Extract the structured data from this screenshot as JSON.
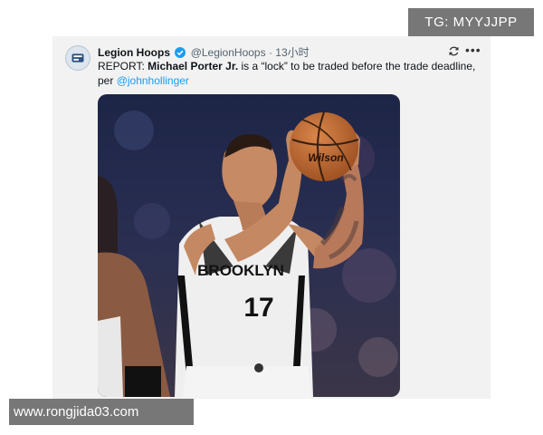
{
  "watermark_top": "TG: MYYJJPP",
  "watermark_bottom": "www.rongjida03.com",
  "tweet": {
    "display_name": "Legion Hoops",
    "handle": "@LegionHoops",
    "separator": "·",
    "time": "13小时",
    "text_prefix": "REPORT: ",
    "player": "Michael Porter Jr.",
    "text_middle": " is a “lock” to be traded before the trade deadline, per ",
    "mention": "@johnhollinger"
  },
  "icons": {
    "avatar": "legion-hoops-logo",
    "verified": "verified-badge-icon",
    "sync": "sync-icon",
    "more": "more-icon"
  },
  "photo": {
    "jersey_text": "BROOKLYN",
    "jersey_number": "17",
    "ball_text": "Wilson"
  },
  "colors": {
    "link": "#1d9bf0",
    "card_bg": "#f2f2f2",
    "watermark_bg": "#777777"
  }
}
